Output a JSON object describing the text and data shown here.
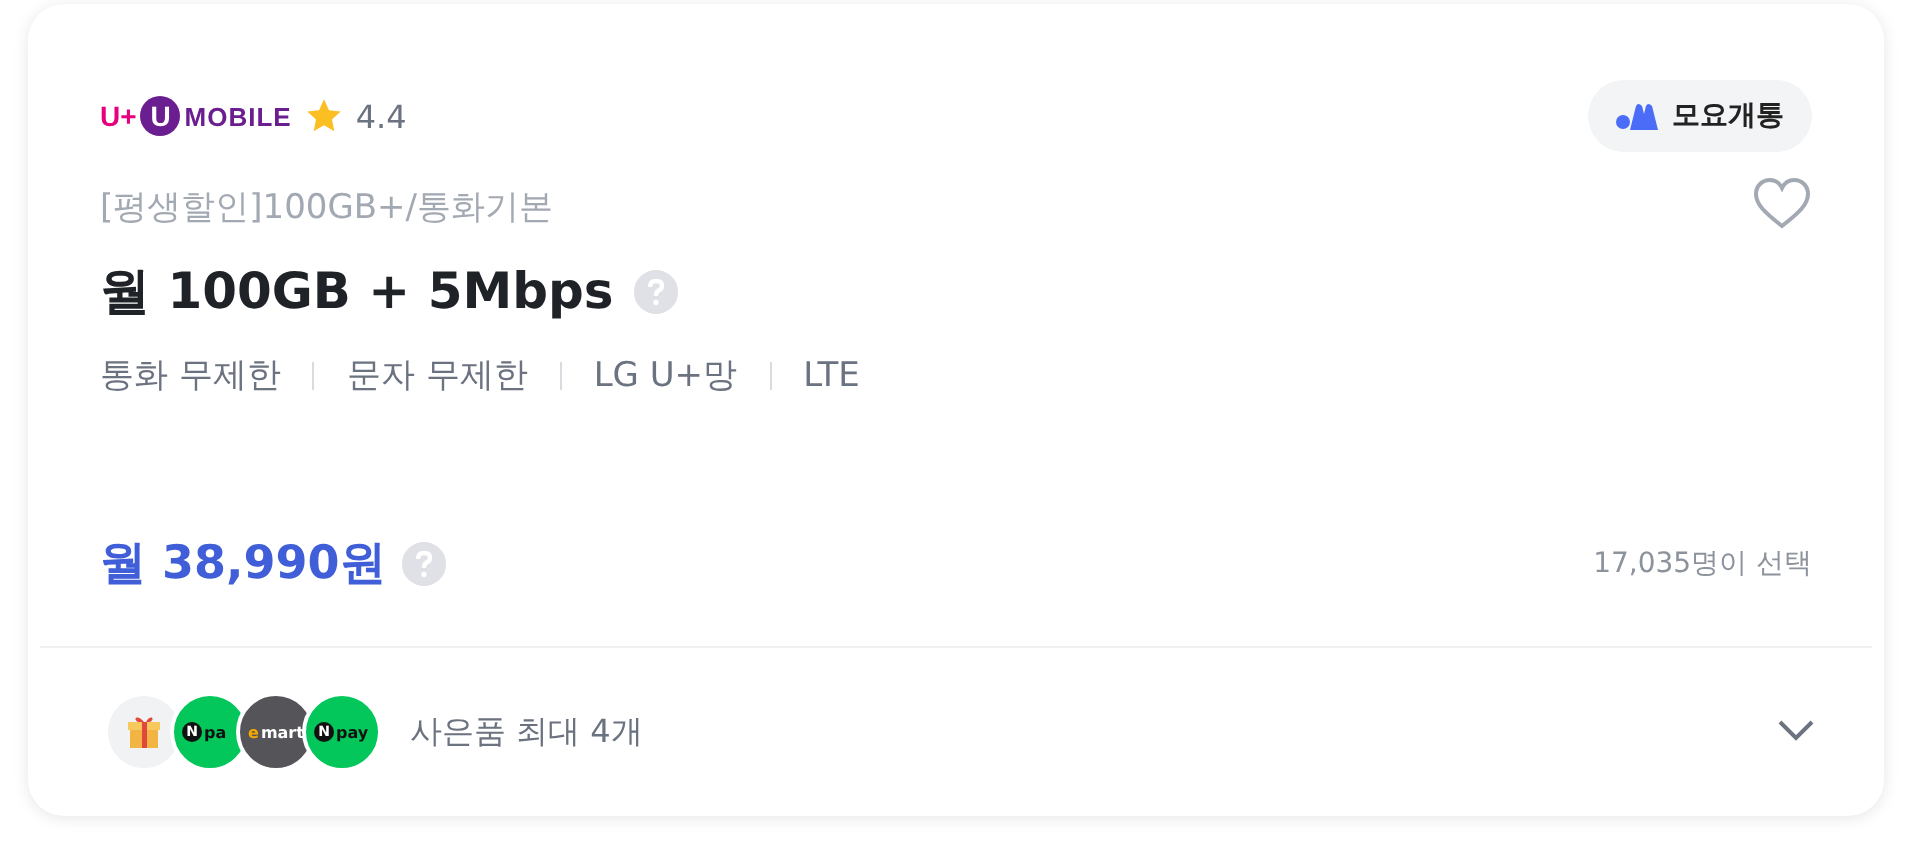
{
  "carrier": {
    "logo_prefix": "U+",
    "logo_badge": "U",
    "logo_text": "MOBILE",
    "rating": "4.4"
  },
  "operator_badge": {
    "label": "모요개통"
  },
  "plan_tag": "[평생할인]100GB+/통화기본",
  "favorite": {
    "selected": false
  },
  "plan_title": "월 100GB + 5Mbps",
  "features": [
    "통화 무제한",
    "문자 무제한",
    "LG U+망",
    "LTE"
  ],
  "price": "월 38,990원",
  "subscribers": "17,035명이 선택",
  "gifts": {
    "items": [
      {
        "kind": "gift"
      },
      {
        "kind": "npay",
        "mark": "N",
        "label": "pa"
      },
      {
        "kind": "emart",
        "mark": "e",
        "label": "mart"
      },
      {
        "kind": "npay",
        "mark": "N",
        "label": "pay"
      }
    ],
    "summary": "사은품 최대 4개",
    "expanded": false
  }
}
